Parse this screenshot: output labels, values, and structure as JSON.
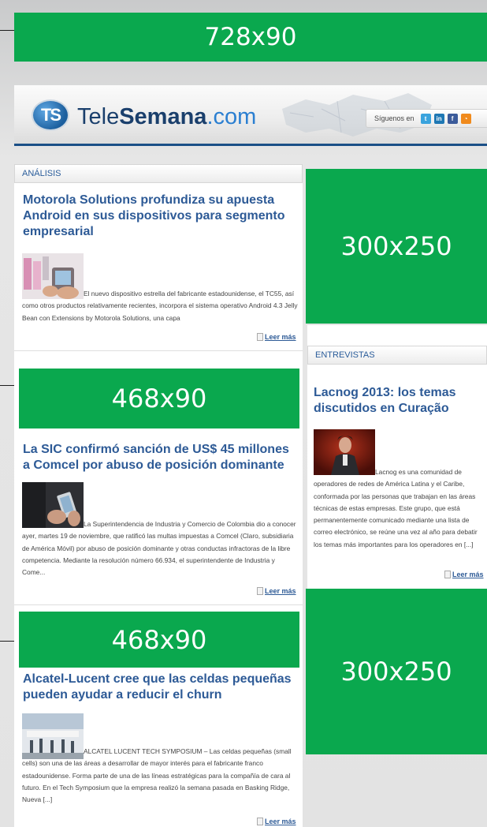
{
  "ads": {
    "top": "728x90",
    "mid1": "468x90",
    "mid2": "468x90",
    "side1": "300x250",
    "side2": "300x250"
  },
  "header": {
    "logo_mark": "TS",
    "logo_tele": "Tele",
    "logo_semana": "Semana",
    "logo_com": ".com",
    "follow_label": "Síguenos en",
    "social_icons": [
      "twitter-icon",
      "linkedin-icon",
      "facebook-icon",
      "rss-icon"
    ]
  },
  "colors": {
    "ad_green": "#0aa84e",
    "title_blue": "#2d5a96",
    "brand_navy": "#1a3f6c"
  },
  "analisis": {
    "section_label": "ANÁLISIS",
    "articles": [
      {
        "title": "Motorola Solutions profundiza su apuesta Android en sus dispositivos para segmento empresarial",
        "excerpt": "El nuevo dispositivo estrella del fabricante estadounidense, el TC55, así como otros productos relativamente recientes, incorpora el sistema operativo Android 4.3 Jelly Bean con Extensions by Motorola Solutions, una capa",
        "more": "Leer más"
      },
      {
        "title": "La SIC confirmó sanción de US$ 45 millones a Comcel por abuso de posición dominante",
        "excerpt": "La Superintendencia de Industria y Comercio de Colombia dio a conocer ayer, martes 19 de noviembre, que ratificó las multas impuestas a Comcel (Claro, subsidiaria de América Móvil) por abuso de posición dominante y otras conductas infractoras de la libre competencia. Mediante la resolución número 66.934, el superintendente de Industria y Come...",
        "more": "Leer más"
      },
      {
        "title": "Alcatel-Lucent cree que las celdas pequeñas pueden ayudar a reducir el churn",
        "excerpt": "ALCATEL LUCENT TECH SYMPOSIUM – Las celdas pequeñas (small cells) son una de las áreas a desarrollar de mayor interés para el fabricante franco estadounidense. Forma parte de una de las líneas estratégicas para la compañía de cara al futuro. En el Tech Symposium que la empresa realizó la semana pasada en Basking Ridge, Nueva [...]",
        "more": "Leer más"
      }
    ]
  },
  "entrevistas": {
    "section_label": "ENTREVISTAS",
    "article": {
      "title": "Lacnog 2013: los temas discutidos en Curação",
      "excerpt": "Lacnog es una comunidad de operadores de redes de América Latina y el Caribe, conformada por las personas que trabajan en las áreas técnicas de estas empresas. Este grupo, que está permanentemente comunicado mediante una lista de correo electrónico, se reúne una vez al año para debatir los temas más importantes para los operadores en [...]",
      "more": "Leer más"
    }
  }
}
